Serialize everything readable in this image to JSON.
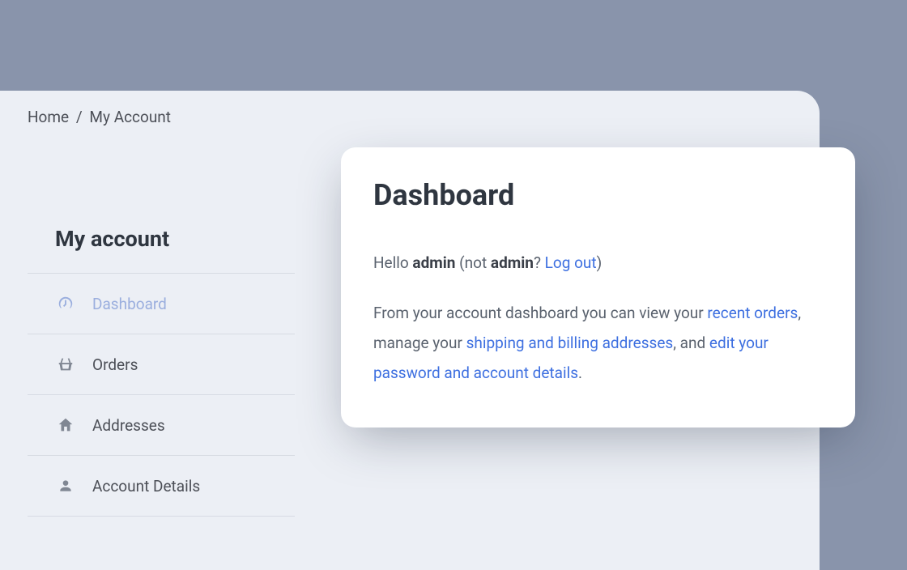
{
  "breadcrumb": {
    "home": "Home",
    "sep": "/",
    "current": "My Account"
  },
  "sidebar": {
    "title": "My account",
    "items": [
      {
        "label": "Dashboard"
      },
      {
        "label": "Orders"
      },
      {
        "label": "Addresses"
      },
      {
        "label": "Account Details"
      }
    ]
  },
  "card": {
    "title": "Dashboard",
    "hello_prefix": "Hello ",
    "user": "admin",
    "not_prefix": " (not ",
    "user2": "admin",
    "not_suffix": "? ",
    "logout": "Log out",
    "close_paren": ")",
    "desc_1": "From your account dashboard you can view your ",
    "link_orders": "recent orders",
    "desc_2": ", manage your ",
    "link_addresses": "shipping and billing addresses",
    "desc_3": ", and ",
    "link_edit": "edit your password and account details",
    "desc_4": "."
  }
}
